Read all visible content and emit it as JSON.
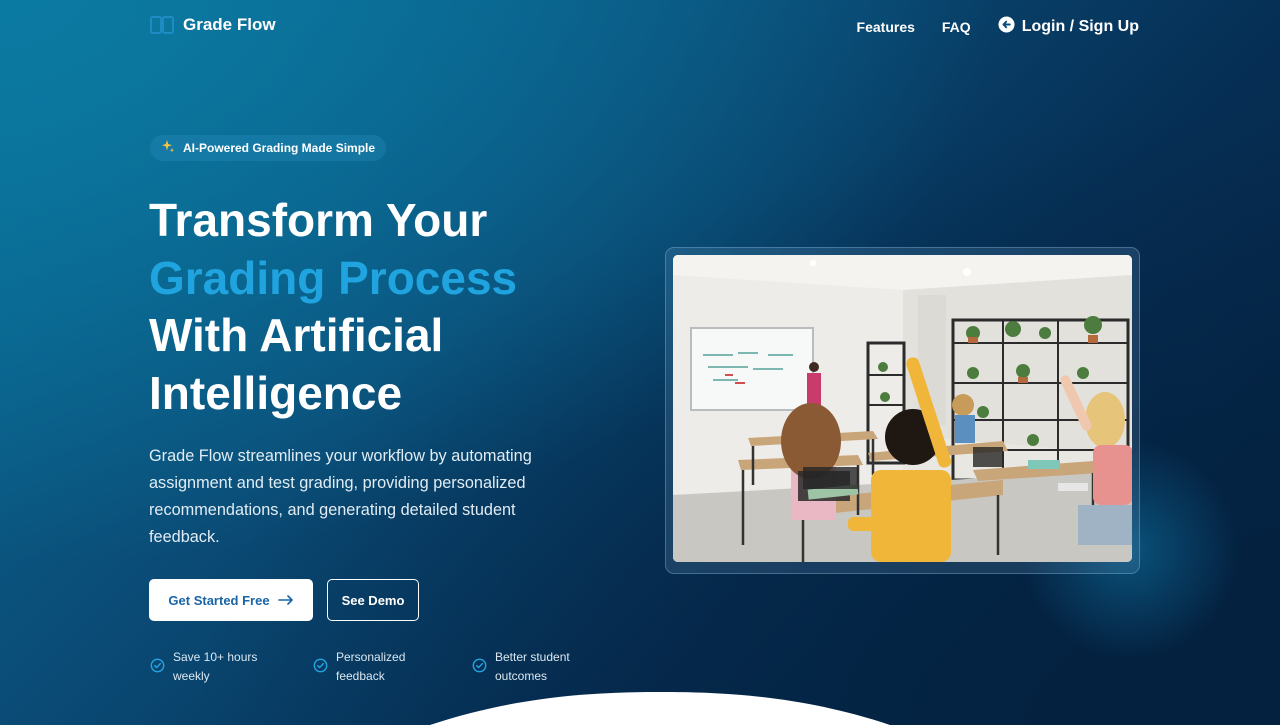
{
  "nav": {
    "brand": "Grade Flow",
    "links": [
      "Features",
      "FAQ"
    ],
    "login_label": "Login / Sign Up"
  },
  "hero": {
    "badge": "AI-Powered Grading Made Simple",
    "headline": {
      "line1": "Transform Your",
      "line2": "Grading Process",
      "line3": "With Artificial",
      "line4": "Intelligence"
    },
    "description": "Grade Flow streamlines your workflow by automating assignment and test grading, providing personalized recommendations, and generating detailed student feedback.",
    "primary_cta": "Get Started Free",
    "secondary_cta": "See Demo",
    "benefits": [
      "Save 10+ hours weekly",
      "Personalized feedback",
      "Better student outcomes"
    ]
  },
  "colors": {
    "accent": "#20a4e0",
    "primary_button_text": "#1a64a6",
    "background_dark": "#041f3d",
    "background_light": "#0a6e96"
  },
  "icons": {
    "logo": "book-icon",
    "login": "arrow-left-circle-icon",
    "badge": "sparkles-icon",
    "cta_arrow": "arrow-right-icon",
    "benefit": "check-circle-icon"
  }
}
